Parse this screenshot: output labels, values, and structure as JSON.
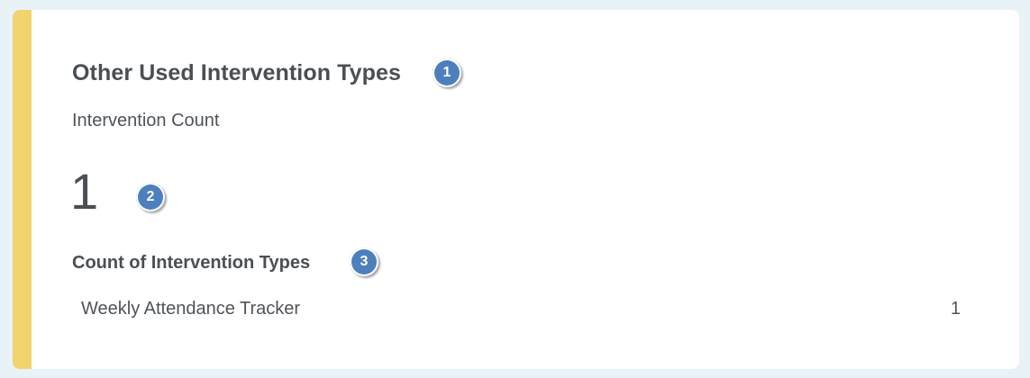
{
  "card": {
    "title": "Other Used Intervention Types",
    "count_label": "Intervention Count",
    "count_value": "1",
    "section_title": "Count of Intervention Types",
    "rows": [
      {
        "name": "Weekly Attendance Tracker",
        "count": "1"
      }
    ],
    "accent_color": "#f3d36e"
  },
  "badges": [
    "1",
    "2",
    "3"
  ]
}
